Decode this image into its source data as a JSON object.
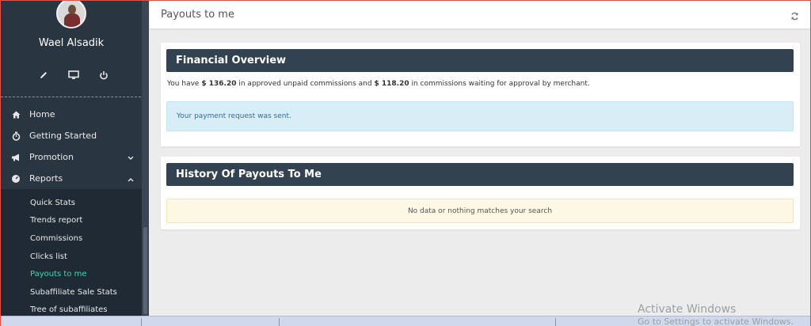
{
  "user": {
    "name": "Wael Alsadik"
  },
  "quick_icons": [
    "pencil-icon",
    "monitor-icon",
    "power-icon"
  ],
  "nav": {
    "items": [
      {
        "label": "Home",
        "icon": "home-icon"
      },
      {
        "label": "Getting Started",
        "icon": "stopwatch-icon"
      },
      {
        "label": "Promotion",
        "icon": "bullhorn-icon",
        "expanded": false
      },
      {
        "label": "Reports",
        "icon": "dashboard-icon",
        "expanded": true
      }
    ],
    "sub_items": [
      {
        "label": "Quick Stats"
      },
      {
        "label": "Trends report"
      },
      {
        "label": "Commissions"
      },
      {
        "label": "Clicks list"
      },
      {
        "label": "Payouts to me",
        "active": true
      },
      {
        "label": "Subaffiliate Sale Stats"
      },
      {
        "label": "Tree of subaffiliates"
      }
    ]
  },
  "header": {
    "title": "Payouts to me"
  },
  "financial": {
    "title": "Financial Overview",
    "summary_prefix": "You have",
    "approved_amount": "$ 136.20",
    "summary_middle": "in approved unpaid commissions and",
    "pending_amount": "$ 118.20",
    "summary_suffix": "in commissions waiting for approval by merchant.",
    "alert": "Your payment request was sent."
  },
  "history": {
    "title": "History Of Payouts To Me",
    "empty_message": "No data or nothing matches your search"
  },
  "watermark": {
    "line1": "Activate Windows",
    "line2": "Go to Settings to activate Windows."
  },
  "colors": {
    "sidebar": "#2a3542",
    "active": "#3fd3b5",
    "panel_header": "#334251",
    "info_bg": "#d9edf7",
    "warn_bg": "#fcf8e3"
  }
}
